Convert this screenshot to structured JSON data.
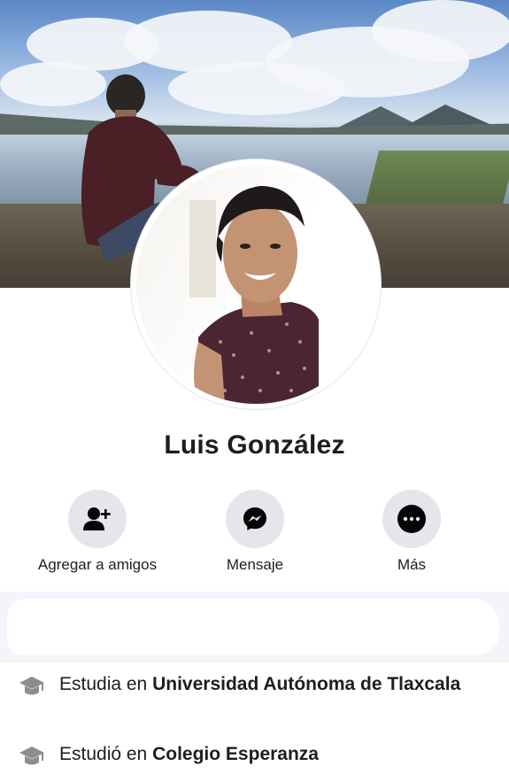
{
  "profile": {
    "name": "Luis González"
  },
  "actions": [
    {
      "label": "Agregar a amigos",
      "icon": "add-friend-icon"
    },
    {
      "label": "Mensaje",
      "icon": "messenger-icon"
    },
    {
      "label": "Más",
      "icon": "more-icon"
    }
  ],
  "info": [
    {
      "prefix": "Estudia en",
      "place": "Universidad Autónoma de Tlaxcala",
      "icon": "graduation-cap-icon"
    },
    {
      "prefix": "Estudió en",
      "place": "Colegio Esperanza",
      "icon": "graduation-cap-icon"
    }
  ],
  "colors": {
    "button_bg": "#e4e6eb",
    "text": "#1c1e21",
    "icon_gray": "#8a8d91",
    "redacted_bg": "#f3f5fb"
  }
}
